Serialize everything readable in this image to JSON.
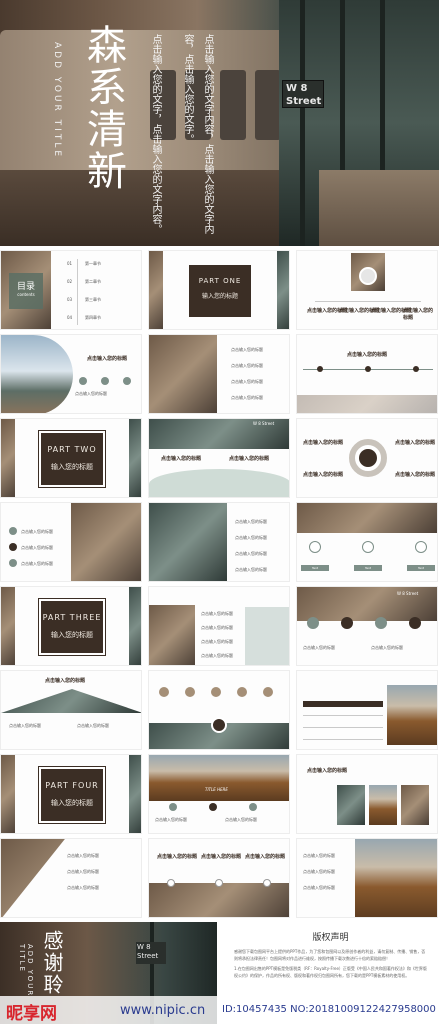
{
  "hero": {
    "title": "森系清新",
    "subtitle_en": "ADD YOUR TITLE",
    "sign": "W 8 Street",
    "body_lines": [
      "点击输入您的文字内容，点击输入您的文字内",
      "容，点击输入您的文字。",
      "点击输入您的文字，点击输入您的文字内容。"
    ]
  },
  "toc": {
    "title": "目录",
    "subtitle": "contents",
    "items": [
      "01",
      "02",
      "03",
      "04"
    ],
    "labels": [
      "第一章节",
      "第二章节",
      "第三章节",
      "第四章节"
    ]
  },
  "parts": [
    {
      "label": "PART ONE",
      "title": "输入您的标题"
    },
    {
      "label": "PART TWO",
      "title": "输入您的标题"
    },
    {
      "label": "PART THREE",
      "title": "输入您的标题"
    },
    {
      "label": "PART FOUR",
      "title": "输入您的标题"
    }
  ],
  "slides": {
    "click_title": "点击输入您的标题",
    "title_here": "TITLE HERE",
    "sign": "W 8 Street",
    "tag": "Text",
    "row_text": "点击输入您的标题"
  },
  "thanks": {
    "title": "感谢聆",
    "subtitle_en": "ADD YOUR TITLE"
  },
  "copyright": {
    "title": "版权声明",
    "paragraphs": [
      "感谢您下载包图网平台上提供的PPT作品，为了您和包图网以及原创作者的利益，请勿复制、传播、销售，否则将承担法律责任！包图网将对作品进行维权，按照传播下载次数进行十倍的索赔赔偿！",
      "1.在包图网出售的PPT模板是免版税类（RF：Royalty-Free）正版受《中国人民共和国著作权法》和《世界版权公约》的保护，作品的所有权、版权和著作权归包图网所有，您下载的是PPT模板素材的使用权。"
    ]
  },
  "watermark": {
    "logo": "昵享网",
    "site": "www.nipic.cn",
    "id": "ID:10457435 NO:20181009122427958000"
  }
}
